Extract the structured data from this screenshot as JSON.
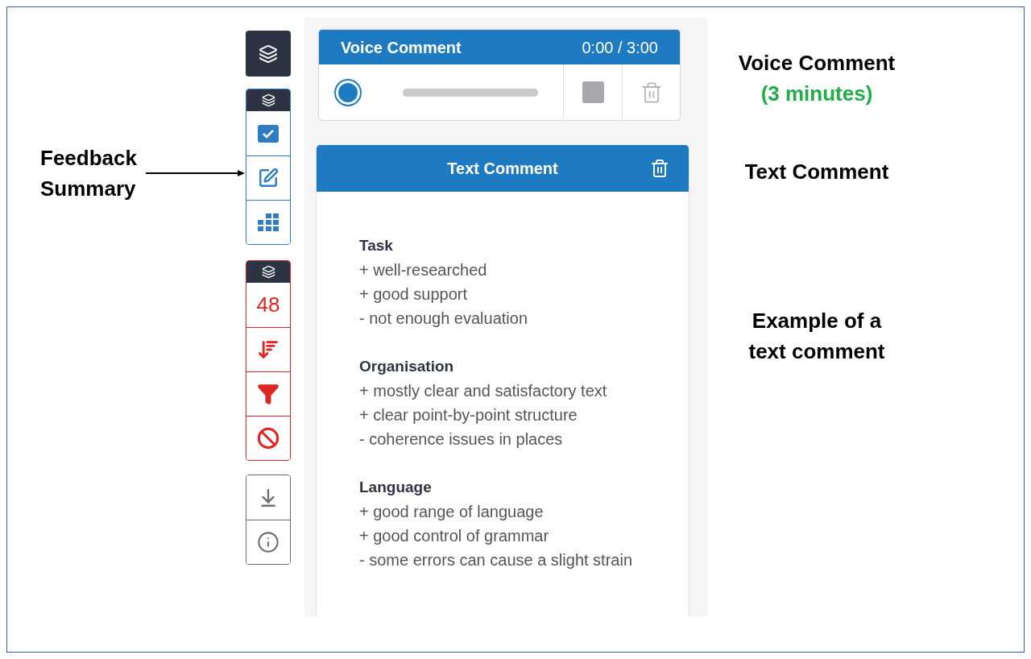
{
  "callout": {
    "text": "Feedback Summary"
  },
  "sidebar": {
    "top_button": {
      "kind": "layers"
    },
    "groups": [
      {
        "color": "#2f7bc4",
        "items": [
          {
            "kind": "check"
          },
          {
            "kind": "edit"
          },
          {
            "kind": "grid"
          }
        ]
      },
      {
        "color": "#e02424",
        "items": [
          {
            "kind": "count",
            "text": "48"
          },
          {
            "kind": "sort"
          },
          {
            "kind": "filter"
          },
          {
            "kind": "block"
          }
        ]
      },
      {
        "color": "#6b6f76",
        "items": [
          {
            "kind": "download"
          },
          {
            "kind": "info"
          }
        ]
      }
    ]
  },
  "voice_comment": {
    "title": "Voice Comment",
    "time": "0:00 / 3:00"
  },
  "text_comment": {
    "title": "Text Comment",
    "sections": [
      {
        "heading": "Task",
        "lines": [
          "+ well-researched",
          "+ good support",
          "- not enough evaluation"
        ]
      },
      {
        "heading": "Organisation",
        "lines": [
          "+ mostly clear and satisfactory text",
          "+ clear point-by-point structure",
          "-  coherence issues in places"
        ]
      },
      {
        "heading": "Language",
        "lines": [
          "+ good range of language",
          "+ good control of grammar",
          "- some errors can cause a slight strain"
        ]
      }
    ]
  },
  "labels": {
    "voice": "Voice Comment",
    "duration": "(3 minutes)",
    "text": "Text Comment",
    "example": "Example of a text comment"
  }
}
